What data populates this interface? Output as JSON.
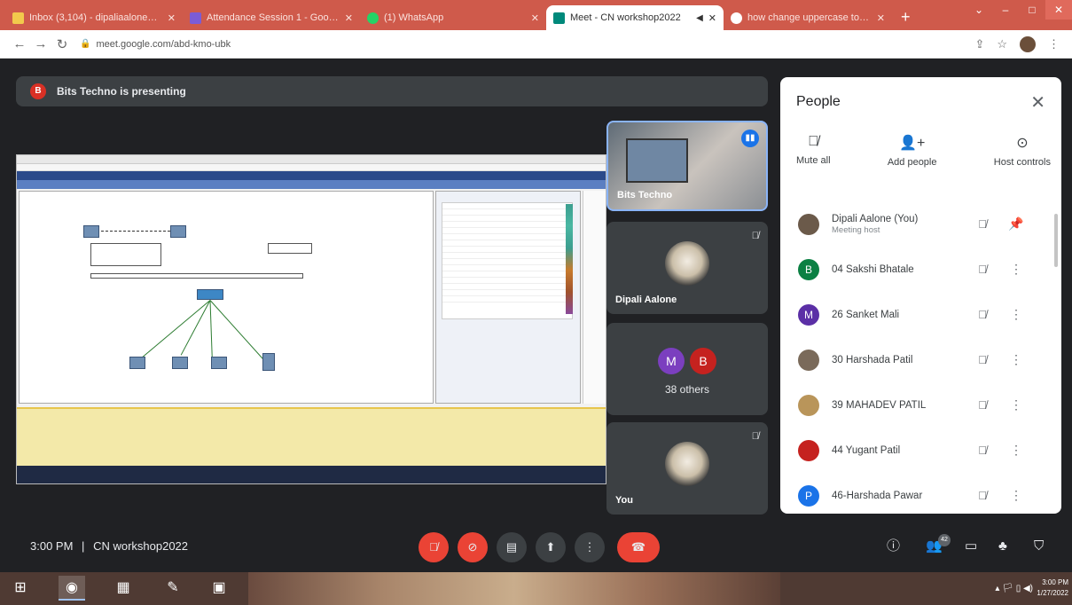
{
  "browser": {
    "tabs": [
      {
        "title": "Inbox (3,104) - dipaliaalone@...",
        "favicon": "gmail-icon",
        "color": "#f2c94c",
        "active": false
      },
      {
        "title": "Attendance Session 1 - Google...",
        "favicon": "forms-icon",
        "color": "#7b5cd6",
        "active": false
      },
      {
        "title": "(1) WhatsApp",
        "favicon": "whatsapp-icon",
        "color": "#25d366",
        "active": false
      },
      {
        "title": "Meet - CN workshop2022",
        "favicon": "meet-icon",
        "color": "#00897b",
        "active": true
      },
      {
        "title": "how change uppercase to low...",
        "favicon": "google-icon",
        "color": "#4285f4",
        "active": false
      }
    ],
    "new_tab": "+",
    "url": "meet.google.com/abd-kmo-ubk",
    "window_controls": {
      "dropdown": "⌄",
      "minimize": "–",
      "maximize": "□",
      "close": "✕"
    }
  },
  "stage": {
    "presenter_initial": "B",
    "presenter_text": "Bits Techno is presenting"
  },
  "tiles": [
    {
      "name": "Bits Techno",
      "type": "video"
    },
    {
      "name": "Dipali Aalone",
      "type": "avatar",
      "muted": true
    },
    {
      "name": "38 others",
      "type": "group",
      "initials": [
        "M",
        "B"
      ],
      "colors": [
        "#7b3fbf",
        "#c5221f"
      ]
    },
    {
      "name": "You",
      "type": "avatar",
      "muted": true
    }
  ],
  "people_panel": {
    "title": "People",
    "controls": [
      {
        "label": "Mute all",
        "icon": "mic-off-icon"
      },
      {
        "label": "Add people",
        "icon": "add-person-icon"
      },
      {
        "label": "Host controls",
        "icon": "toggle-icon"
      }
    ],
    "participants": [
      {
        "initial": "",
        "name": "Dipali Aalone (You)",
        "sub": "Meeting host",
        "color": "#6b5a4a",
        "photo": true,
        "action": "pin"
      },
      {
        "initial": "B",
        "name": "04 Sakshi Bhatale",
        "sub": "",
        "color": "#0b8043",
        "photo": false,
        "action": "more"
      },
      {
        "initial": "M",
        "name": "26 Sanket Mali",
        "sub": "",
        "color": "#5b2fa6",
        "photo": false,
        "action": "more"
      },
      {
        "initial": "",
        "name": "30 Harshada Patil",
        "sub": "",
        "color": "#7a6a5a",
        "photo": true,
        "action": "more"
      },
      {
        "initial": "",
        "name": "39 MAHADEV PATIL",
        "sub": "",
        "color": "#b9955a",
        "photo": true,
        "action": "more"
      },
      {
        "initial": "",
        "name": "44 Yugant Patil",
        "sub": "",
        "color": "#c5221f",
        "photo": true,
        "action": "more"
      },
      {
        "initial": "P",
        "name": "46-Harshada Pawar",
        "sub": "",
        "color": "#1a73e8",
        "photo": false,
        "action": "more"
      }
    ]
  },
  "meetbar": {
    "time": "3:00 PM",
    "separator": "|",
    "meeting": "CN workshop2022",
    "people_count": "42"
  },
  "taskbar": {
    "clock_time": "3:00 PM",
    "clock_date": "1/27/2022"
  },
  "colors": {
    "meet_bg": "#202124",
    "tile_bg": "#3c4043",
    "danger": "#ea4335",
    "tab_strip": "#cf5a4b"
  }
}
